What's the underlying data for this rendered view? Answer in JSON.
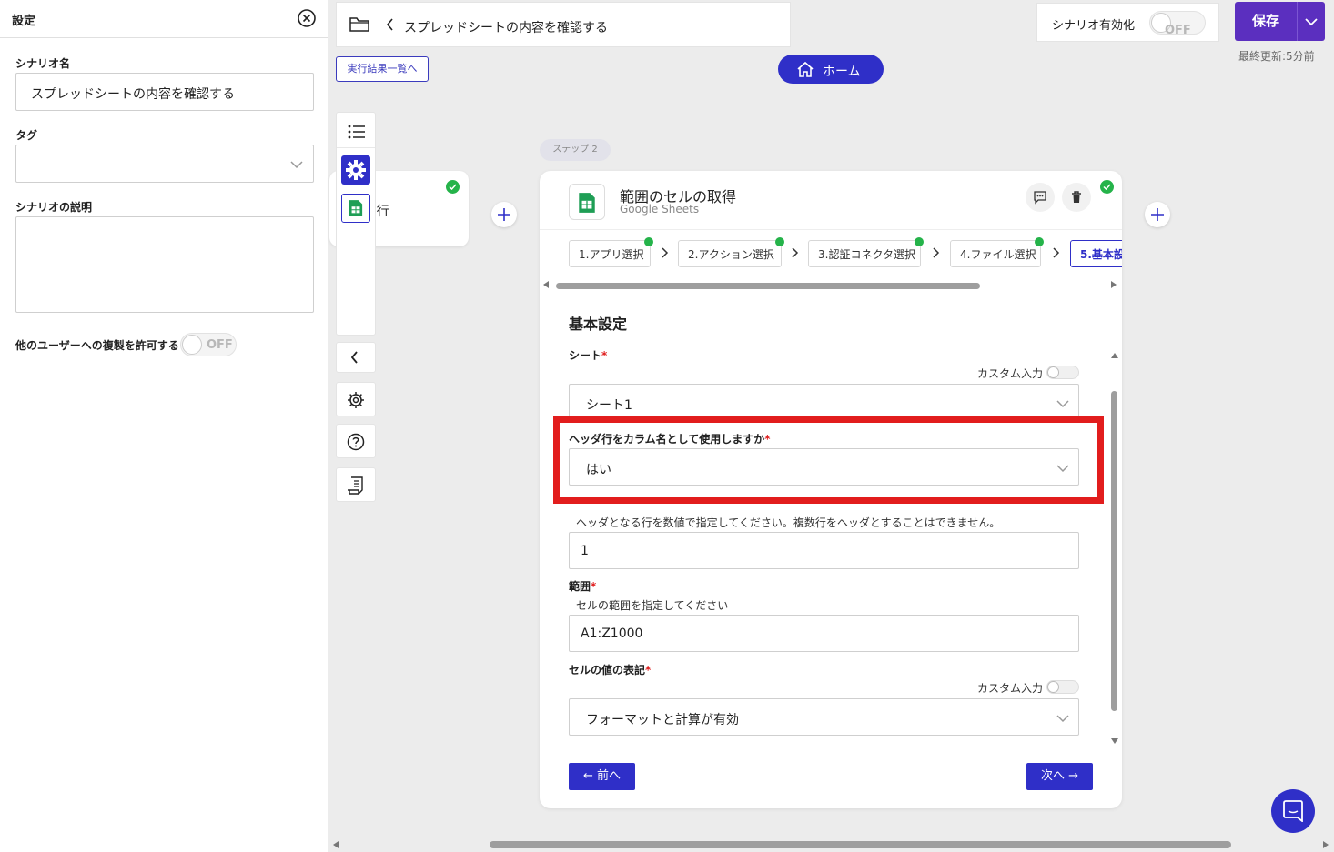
{
  "settings_panel": {
    "title": "設定",
    "scenario_name_label": "シナリオ名",
    "scenario_name_value": "スプレッドシートの内容を確認する",
    "tag_label": "タグ",
    "tag_value": "",
    "description_label": "シナリオの説明",
    "description_value": "",
    "allow_copy_label": "他のユーザーへの複製を許可する",
    "allow_copy_state": "OFF"
  },
  "header": {
    "breadcrumb_title": "スプレッドシートの内容を確認する",
    "run_results_link": "実行結果一覧へ",
    "home_label": "ホーム",
    "enable_label": "シナリオ有効化",
    "enable_state": "OFF",
    "save_label": "保存",
    "last_updated": "最終更新:5分前"
  },
  "step1": {
    "text": "して実行"
  },
  "step_badge": "ステップ 2",
  "card": {
    "action_title": "範囲のセルの取得",
    "app_name": "Google Sheets",
    "tabs": [
      {
        "label": "1.アプリ選択",
        "done": true
      },
      {
        "label": "2.アクション選択",
        "done": true
      },
      {
        "label": "3.認証コネクタ選択",
        "done": true
      },
      {
        "label": "4.ファイル選択",
        "done": true
      },
      {
        "label": "5.基本設",
        "done": false
      }
    ],
    "section_title": "基本設定",
    "custom_input_label": "カスタム入力",
    "fields": {
      "sheet": {
        "label": "シート",
        "value": "シート1"
      },
      "use_header": {
        "label": "ヘッダ行をカラム名として使用しますか",
        "value": "はい"
      },
      "header_row": {
        "help": "ヘッダとなる行を数値で指定してください。複数行をヘッダとすることはできません。",
        "value": "1"
      },
      "range": {
        "label": "範囲",
        "help": "セルの範囲を指定してください",
        "value": "A1:Z1000"
      },
      "cell_format": {
        "label": "セルの値の表記",
        "value": "フォーマットと計算が有効"
      }
    },
    "required_mark": "*",
    "prev_label": "← 前へ",
    "next_label": "次へ →"
  },
  "colors": {
    "accent": "#2f2fc8",
    "save": "#5b2fbf",
    "success": "#25b34a",
    "highlight": "#e21d1d",
    "sheets_green": "#1e9e55"
  }
}
